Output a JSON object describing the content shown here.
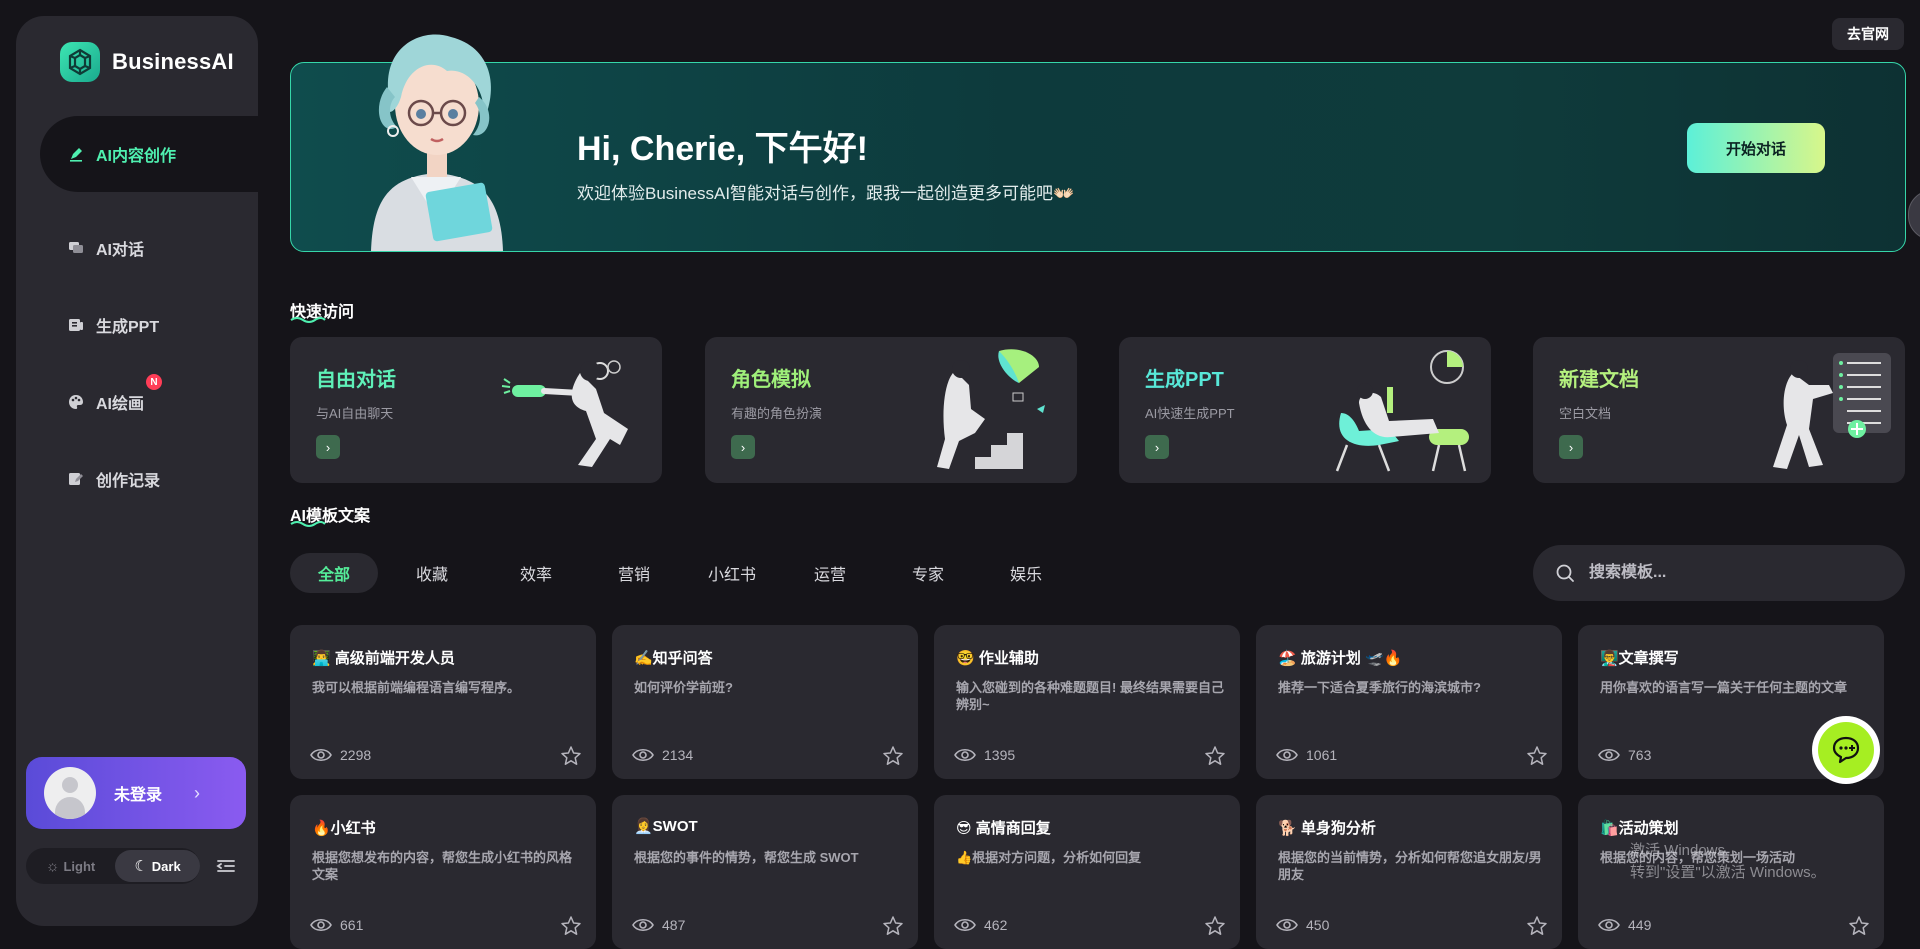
{
  "brand": {
    "name": "BusinessAI"
  },
  "sidebar": {
    "items": [
      {
        "label": "AI内容创作",
        "icon": "pen-icon",
        "active": true
      },
      {
        "label": "AI对话",
        "icon": "chat-bubbles-icon"
      },
      {
        "label": "生成PPT",
        "icon": "presentation-icon"
      },
      {
        "label": "AI绘画",
        "icon": "palette-icon",
        "badge": "N"
      },
      {
        "label": "创作记录",
        "icon": "edit-record-icon"
      }
    ],
    "login_label": "未登录",
    "theme": {
      "light": "Light",
      "dark": "Dark",
      "selected": "Dark"
    }
  },
  "top_link": "去官网",
  "hero": {
    "title": "Hi, Cherie, 下午好!",
    "subtitle": "欢迎体验BusinessAI智能对话与创作，跟我一起创造更多可能吧👐🏻",
    "button": "开始对话"
  },
  "quick_access": {
    "title": "快速访问",
    "cards": [
      {
        "title": "自由对话",
        "desc": "与AI自由聊天",
        "color": "#5ff0b8"
      },
      {
        "title": "角色模拟",
        "desc": "有趣的角色扮演",
        "color": "#9ff07a"
      },
      {
        "title": "生成PPT",
        "desc": "AI快速生成PPT",
        "color": "#58e8d8"
      },
      {
        "title": "新建文档",
        "desc": "空白文档",
        "color": "#b4f07e"
      }
    ]
  },
  "templates": {
    "title": "AI模板文案",
    "tabs": [
      "全部",
      "收藏",
      "效率",
      "营销",
      "小红书",
      "运营",
      "专家",
      "娱乐"
    ],
    "active_tab": "全部",
    "search_placeholder": "搜索模板...",
    "cards": [
      {
        "title": "👨‍💻 高级前端开发人员",
        "desc": "我可以根据前端编程语言编写程序。",
        "views": "2298"
      },
      {
        "title": "✍️知乎问答",
        "desc": "如何评价学前班?",
        "views": "2134"
      },
      {
        "title": "🤓 作业辅助",
        "desc": "输入您碰到的各种难题题目! 最终结果需要自己辨别~",
        "views": "1395"
      },
      {
        "title": "🏖️ 旅游计划 🛫🔥",
        "desc": "推荐一下适合夏季旅行的海滨城市?",
        "views": "1061"
      },
      {
        "title": "👨‍🏫文章撰写",
        "desc": "用你喜欢的语言写一篇关于任何主题的文章",
        "views": "763"
      },
      {
        "title": "🔥小红书",
        "desc": "根据您想发布的内容，帮您生成小红书的风格文案",
        "views": "661"
      },
      {
        "title": "👩‍💼SWOT",
        "desc": "根据您的事件的情势，帮您生成 SWOT",
        "views": "487"
      },
      {
        "title": "😎 高情商回复",
        "desc": "👍根据对方问题，分析如何回复",
        "views": "462"
      },
      {
        "title": "🐕 单身狗分析",
        "desc": "根据您的当前情势，分析如何帮您追女朋友/男朋友",
        "views": "450"
      },
      {
        "title": "🛍️活动策划",
        "desc": "根据您的内容，帮您策划一场活动",
        "views": "449"
      }
    ]
  },
  "watermark": {
    "line1": "激活 Windows",
    "line2": "转到\"设置\"以激活 Windows。"
  }
}
